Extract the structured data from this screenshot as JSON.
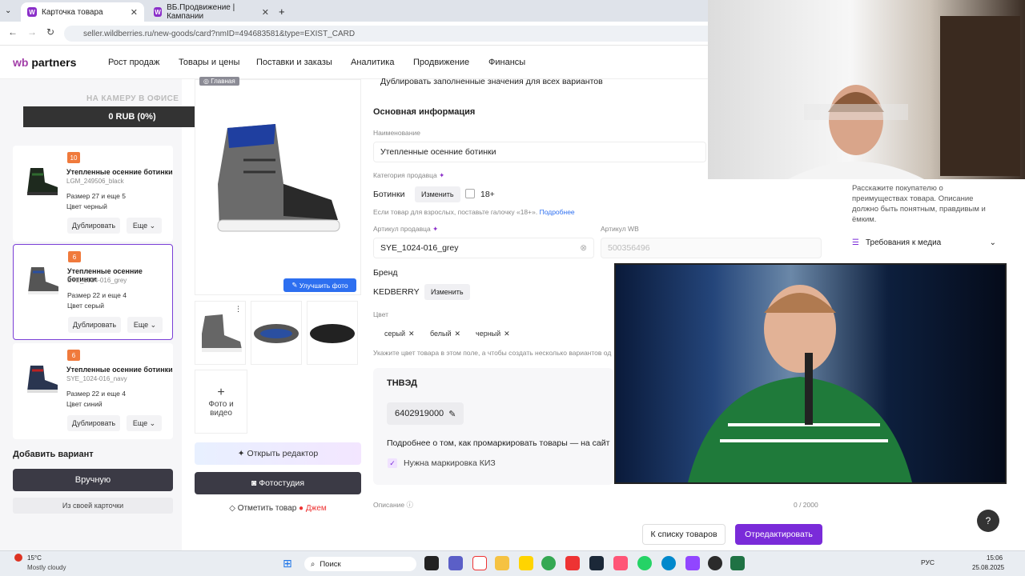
{
  "browser": {
    "tabs": [
      {
        "label": "Карточка товара"
      },
      {
        "label": "ВБ.Продвижение | Кампании"
      }
    ],
    "url": "seller.wildberries.ru/new-goods/card?nmID=494683581&type=EXIST_CARD"
  },
  "logo": {
    "wb": "wb",
    "partners": "partners"
  },
  "nav": {
    "items": [
      "Рост продаж",
      "Товары и цены",
      "Поставки и заказы",
      "Аналитика",
      "Продвижение",
      "Финансы"
    ]
  },
  "promo": {
    "label": "НА КАМЕРУ В ОФИСЕ",
    "value": "0 RUB (0%)"
  },
  "variants": [
    {
      "badge": "10",
      "title": "Утепленные осенние ботинки",
      "sku": "LGM_249506_black",
      "size": "Размер 27 и еще 5",
      "color": "Цвет черный",
      "dup": "Дублировать",
      "more": "Еще"
    },
    {
      "badge": "6",
      "title": "Утепленные осенние ботинки",
      "sku": "SYE_1024-016_grey",
      "size": "Размер 22 и еще 4",
      "color": "Цвет серый",
      "dup": "Дублировать",
      "more": "Еще"
    },
    {
      "badge": "6",
      "title": "Утепленные осенние ботинки",
      "sku": "SYE_1024-016_navy",
      "size": "Размер 22 и еще 4",
      "color": "Цвет синий",
      "dup": "Дублировать",
      "more": "Еще"
    }
  ],
  "sidebar": {
    "add_variant": "Добавить вариант",
    "manual": "Вручную",
    "from_card": "Из своей карточки"
  },
  "media": {
    "main_tag": "Главная",
    "improve": "Улучшить фото",
    "add_photo": "Фото и видео",
    "open_editor": "Открыть редактор",
    "photostudio": "Фотостудия",
    "mark_goods": "Отметить товар",
    "mark_tag": "Джем"
  },
  "form": {
    "duplicate_all": "Дублировать заполненные значения для всех вариантов",
    "section": "Основная информация",
    "name_label": "Наименование",
    "name_value": "Утепленные осенние ботинки",
    "category_label": "Категория продавца",
    "category_value": "Ботинки",
    "change": "Изменить",
    "adult": "18+",
    "adult_hint": "Если товар для взрослых, поставьте галочку «18+».",
    "more_link": "Подробнее",
    "seller_sku_label": "Артикул продавца",
    "seller_sku_value": "SYE_1024-016_grey",
    "wb_sku_label": "Артикул WB",
    "wb_sku_value": "500356496",
    "brand_label": "Бренд",
    "brand_value": "KEDBERRY",
    "color_label": "Цвет",
    "colors": [
      "серый",
      "белый",
      "черный"
    ],
    "color_hint": "Укажите цвет товара в этом поле, а чтобы создать несколько вариантов од",
    "tnved_label": "ТНВЭД",
    "tnved_value": "6402919000",
    "marking_text": "Подробнее о том, как промаркировать товары — на сайт",
    "kiz": "Нужна маркировка КИЗ",
    "desc_label": "Описание",
    "desc_count": "0 / 2000"
  },
  "right": {
    "desc_hint": "Расскажите покупателю о преимуществах товара. Описание должно быть понятным, правдивым и ёмким.",
    "media_req": "Требования к медиа"
  },
  "footer": {
    "to_list": "К списку товаров",
    "edit": "Отредактировать",
    "help": "?"
  },
  "taskbar": {
    "temp": "15°C",
    "weather": "Mostly cloudy",
    "search": "Поиск",
    "lang": "РУС",
    "time": "15:06",
    "date": "25.08.2025"
  },
  "colors": {
    "accent": "#7a2bd9",
    "dark": "#3b3a45",
    "badge": "#f07a3c",
    "link": "#2d6ff0"
  }
}
